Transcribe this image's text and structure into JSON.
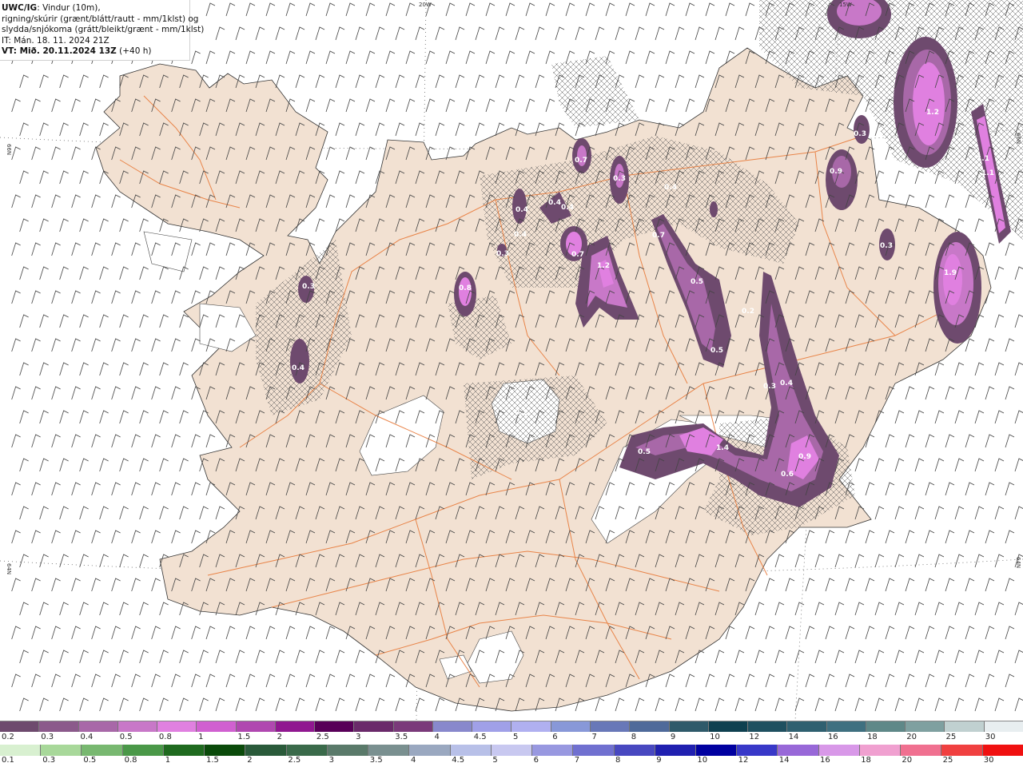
{
  "info": {
    "model_label": "UWC/IG",
    "line1": ": Vindur (10m),",
    "line2": "rigning/skúrir (grænt/blátt/rautt - mm/1klst) og",
    "line3": "slydda/snjókoma (grátt/bleikt/grænt - mm/1klst)",
    "it_line": "IT: Mán. 18. 11. 2024 21Z",
    "vt_label": "VT:",
    "vt_value": " Mið. 20.11.2024 13Z",
    "vt_offset": " (+40 h)"
  },
  "graticule_labels": {
    "top_20w": "20W",
    "top_15w": "15W",
    "left_66n": "66N",
    "left_64n": "64N",
    "right_66n": "66N",
    "right_64n": "64N"
  },
  "precip_values": [
    "1.2",
    "0.3",
    "1.1",
    "1.1",
    "0.9",
    "0.3",
    "1.9",
    "0.5",
    "0.5",
    "0.2",
    "0.4",
    "0.3",
    "0.9",
    "0.6",
    "1.4",
    "0.5",
    "0.2",
    "1.2",
    "0.7",
    "0.4",
    "0.4",
    "0.4",
    "0.3",
    "0.8",
    "0.3",
    "0.4",
    "0.3",
    "0.4",
    "0.7",
    "0.7",
    "0.4"
  ],
  "legend": {
    "snow_labels": [
      "0.2",
      "0.3",
      "0.4",
      "0.5",
      "0.8",
      "1",
      "1.5",
      "2",
      "2.5",
      "3",
      "3.5",
      "4",
      "4.5",
      "5",
      "6",
      "7",
      "8",
      "9",
      "10",
      "12",
      "14",
      "16",
      "18",
      "20",
      "25",
      "30"
    ],
    "snow_colors": [
      "#6e4a6e",
      "#8b5a8b",
      "#a868a8",
      "#c878c8",
      "#e080e0",
      "#d060d0",
      "#b048b0",
      "#901890",
      "#580058",
      "#6a2a6a",
      "#7a3a7a",
      "#8888cc",
      "#a0a0e8",
      "#b0b0f0",
      "#8898d8",
      "#6878b8",
      "#4f6a9a",
      "#2f5a6a",
      "#0f4050",
      "#1f5060",
      "#2f6070",
      "#3f7080",
      "#5f8888",
      "#7fa0a0",
      "#c0d0d0",
      "#e8eef0"
    ],
    "rain_labels": [
      "0.1",
      "0.3",
      "0.5",
      "0.8",
      "1",
      "1.5",
      "2",
      "2.5",
      "3",
      "3.5",
      "4",
      "4.5",
      "5",
      "6",
      "7",
      "8",
      "9",
      "10",
      "12",
      "14",
      "16",
      "18",
      "20",
      "25",
      "30"
    ],
    "rain_colors": [
      "#d8f0d0",
      "#a8d89a",
      "#78b870",
      "#4a9848",
      "#1f6a1f",
      "#0a4a0a",
      "#2a5a3a",
      "#3a6a4a",
      "#5a7a6a",
      "#7a9090",
      "#9aa8c0",
      "#b8c0e8",
      "#c8c8f0",
      "#9898e0",
      "#7070d0",
      "#4848c0",
      "#2020b0",
      "#0000a0",
      "#3838c8",
      "#9868d8",
      "#d898e8",
      "#f0a0d0",
      "#f07090",
      "#f04040",
      "#f01010"
    ]
  }
}
